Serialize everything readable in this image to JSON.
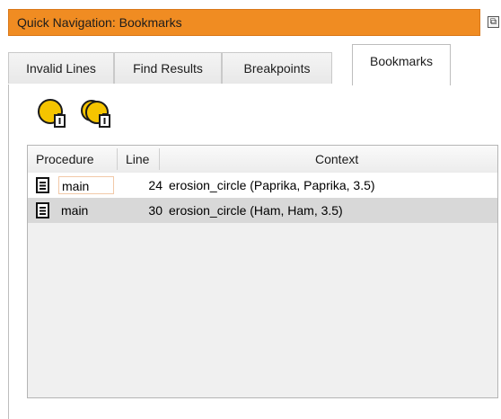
{
  "panel": {
    "title": "Quick Navigation: Bookmarks",
    "float_icon": "restore-window-icon",
    "close_icon": "close-icon"
  },
  "tabs": [
    {
      "label": "Invalid Lines",
      "active": false
    },
    {
      "label": "Find Results",
      "active": false
    },
    {
      "label": "Breakpoints",
      "active": false
    },
    {
      "label": "Bookmarks",
      "active": true
    }
  ],
  "toolbar": {
    "delete_bookmark_icon": "delete-bookmark-icon",
    "delete_all_bookmarks_icon": "delete-all-bookmarks-icon"
  },
  "table": {
    "columns": {
      "procedure": "Procedure",
      "line": "Line",
      "context": "Context"
    },
    "rows": [
      {
        "procedure": "main",
        "line": "24",
        "context": "erosion_circle (Paprika, Paprika, 3.5)",
        "selected": false
      },
      {
        "procedure": "main",
        "line": "30",
        "context": "erosion_circle (Ham, Ham, 3.5)",
        "selected": true
      }
    ]
  },
  "colors": {
    "titlebar": "#f08c22",
    "selected_row": "#d8d8d8",
    "icon_fill": "#f5c400"
  }
}
